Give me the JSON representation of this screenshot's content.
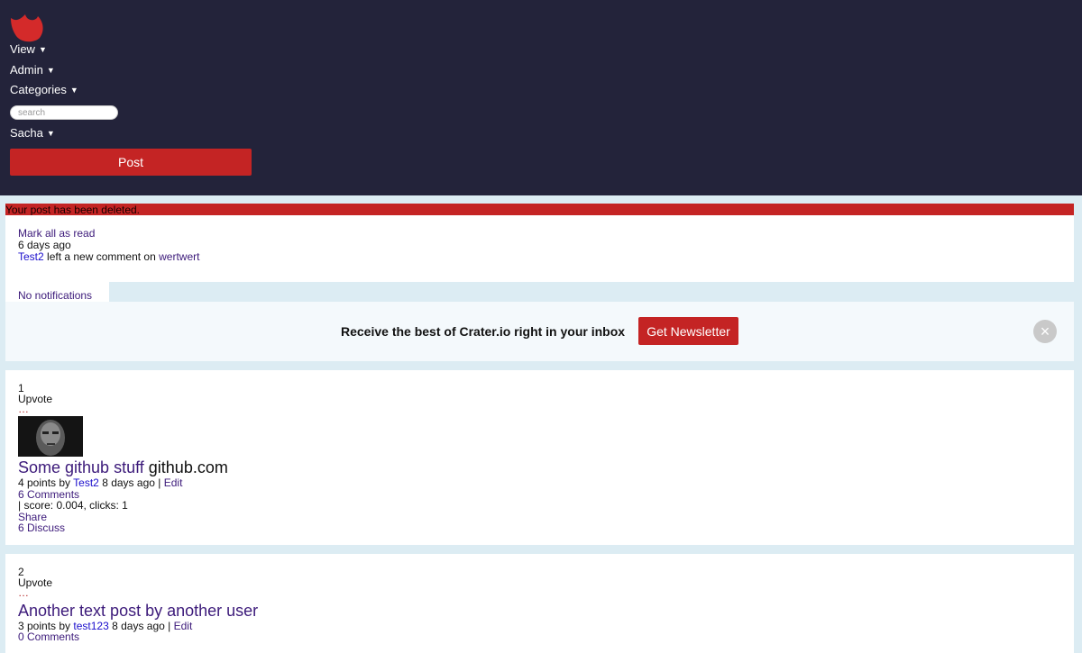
{
  "header": {
    "logo_icon": "crater-logo-icon",
    "menu": {
      "view": "View",
      "admin": "Admin",
      "categories": "Categories",
      "user": "Sacha"
    },
    "caret": "▼",
    "search_placeholder": "search",
    "post_label": "Post"
  },
  "flash": "Your post has been deleted.",
  "notifications": {
    "mark_all": "Mark all as read",
    "time": "6 days ago",
    "actor": "Test2",
    "action": "left a new comment on",
    "target": "wertwert",
    "empty_label": "No notifications"
  },
  "newsletter": {
    "text": "Receive the best of Crater.io right in your inbox",
    "button": "Get Newsletter",
    "close": "×"
  },
  "posts": [
    {
      "rank": "1",
      "upvote": "Upvote",
      "more": "…",
      "title": "Some github stuff",
      "domain": "github.com",
      "points": "4 points by",
      "author": "Test2",
      "age": "8 days ago |",
      "edit": "Edit",
      "comments": "6 Comments",
      "meta": "| score: 0.004, clicks: 1",
      "share": "Share",
      "discuss": "6 Discuss"
    },
    {
      "rank": "2",
      "upvote": "Upvote",
      "more": "…",
      "title": "Another text post by another user",
      "points": "3 points by",
      "author": "test123",
      "age": "8 days ago |",
      "edit": "Edit",
      "comments": "0 Comments"
    }
  ],
  "colors": {
    "header_bg": "#23233a",
    "accent_red": "#c42424",
    "page_bg": "#dcecf3",
    "link_visited": "#3c1a7a",
    "link_blue": "#1a0dcc"
  }
}
